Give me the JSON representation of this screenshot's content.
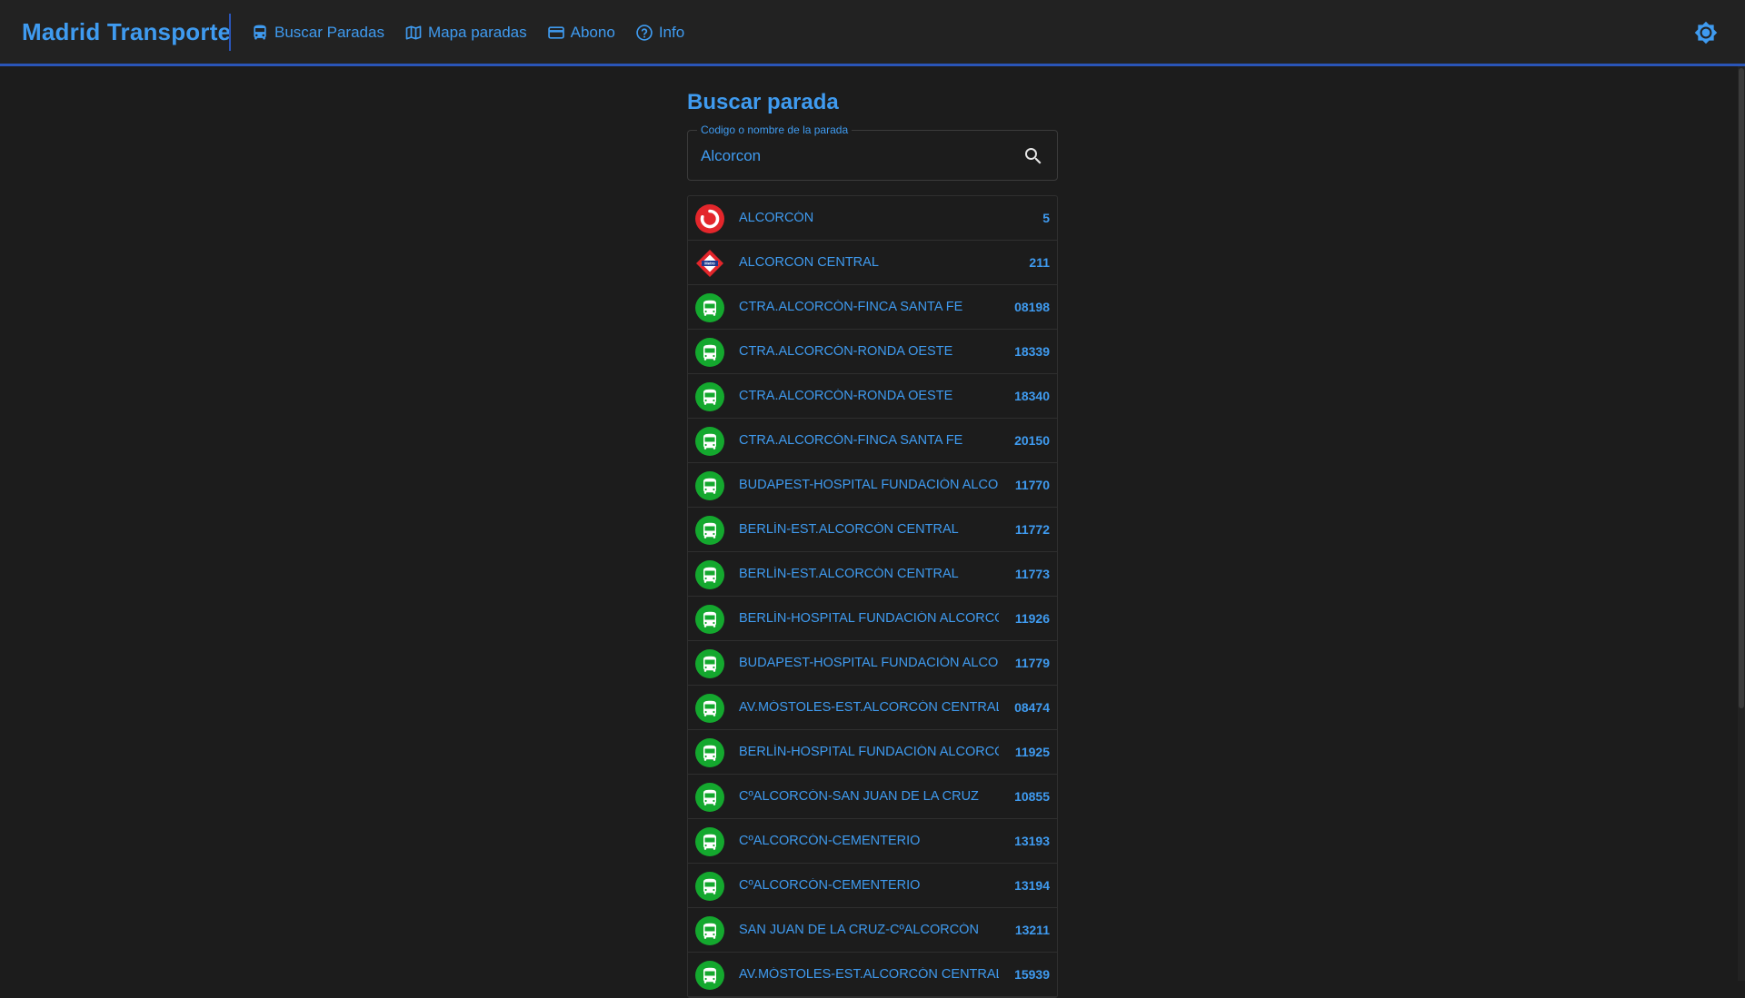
{
  "app": {
    "title": "Madrid Transporte",
    "accent_color": "#3f9bf0",
    "border_color": "#2a55b8"
  },
  "nav": [
    {
      "label": "Buscar Paradas",
      "icon": "bus-icon"
    },
    {
      "label": "Mapa paradas",
      "icon": "map-icon"
    },
    {
      "label": "Abono",
      "icon": "card-icon"
    },
    {
      "label": "Info",
      "icon": "help-circle-icon"
    }
  ],
  "header": {
    "theme_icon": "brightness-icon"
  },
  "main": {
    "title": "Buscar parada"
  },
  "search": {
    "label": "Codigo o nombre de la parada",
    "value": "Alcorcon",
    "icon": "search-icon"
  },
  "results": [
    {
      "type": "cercanias",
      "name": "ALCORCÓN",
      "code": "5"
    },
    {
      "type": "metro",
      "name": "ALCORCON CENTRAL",
      "code": "211"
    },
    {
      "type": "bus",
      "name": "CTRA.ALCORCÓN-FINCA SANTA FE",
      "code": "08198"
    },
    {
      "type": "bus",
      "name": "CTRA.ALCORCÓN-RONDA OESTE",
      "code": "18339"
    },
    {
      "type": "bus",
      "name": "CTRA.ALCORCÓN-RONDA OESTE",
      "code": "18340"
    },
    {
      "type": "bus",
      "name": "CTRA.ALCORCÓN-FINCA SANTA FE",
      "code": "20150"
    },
    {
      "type": "bus",
      "name": "BUDAPEST-HOSPITAL FUNDACIÓN ALCORCÓN",
      "code": "11770"
    },
    {
      "type": "bus",
      "name": "BERLÍN-EST.ALCORCÓN CENTRAL",
      "code": "11772"
    },
    {
      "type": "bus",
      "name": "BERLÍN-EST.ALCORCÓN CENTRAL",
      "code": "11773"
    },
    {
      "type": "bus",
      "name": "BERLÍN-HOSPITAL FUNDACIÓN ALCORCÓN",
      "code": "11926"
    },
    {
      "type": "bus",
      "name": "BUDAPEST-HOSPITAL FUNDACIÓN ALCORCÓN",
      "code": "11779"
    },
    {
      "type": "bus",
      "name": "AV.MÓSTOLES-EST.ALCORCÓN CENTRAL",
      "code": "08474"
    },
    {
      "type": "bus",
      "name": "BERLÍN-HOSPITAL FUNDACIÓN ALCORCÓN",
      "code": "11925"
    },
    {
      "type": "bus",
      "name": "CºALCORCÓN-SAN JUAN DE LA CRUZ",
      "code": "10855"
    },
    {
      "type": "bus",
      "name": "CºALCORCÓN-CEMENTERIO",
      "code": "13193"
    },
    {
      "type": "bus",
      "name": "CºALCORCÓN-CEMENTERIO",
      "code": "13194"
    },
    {
      "type": "bus",
      "name": "SAN JUAN DE LA CRUZ-CºALCORCÓN",
      "code": "13211"
    },
    {
      "type": "bus",
      "name": "AV.MÓSTOLES-EST.ALCORCÓN CENTRAL",
      "code": "15939"
    }
  ]
}
